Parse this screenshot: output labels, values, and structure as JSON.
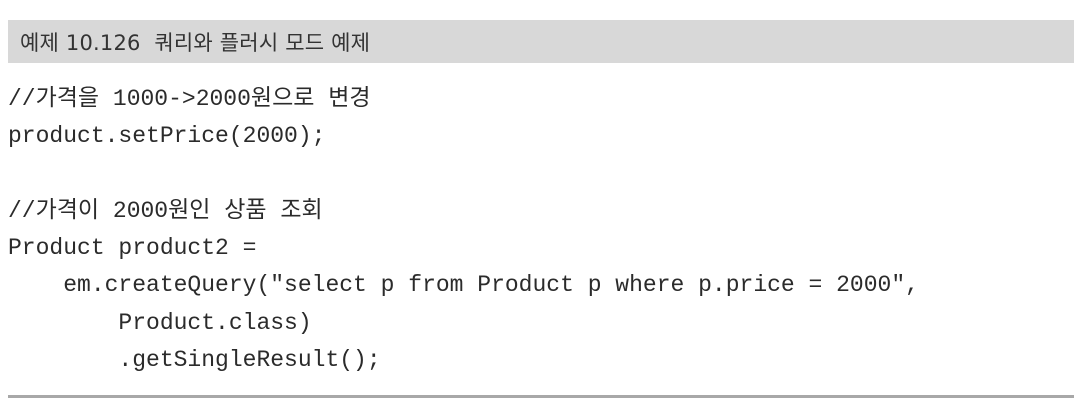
{
  "example": {
    "title": "예제 10.126  쿼리와 플러시 모드 예제"
  },
  "code": {
    "lines": [
      "//가격을 1000->2000원으로 변경",
      "product.setPrice(2000);",
      "",
      "//가격이 2000원인 상품 조회",
      "Product product2 =",
      "    em.createQuery(\"select p from Product p where p.price = 2000\",",
      "        Product.class)",
      "        .getSingleResult();"
    ]
  }
}
